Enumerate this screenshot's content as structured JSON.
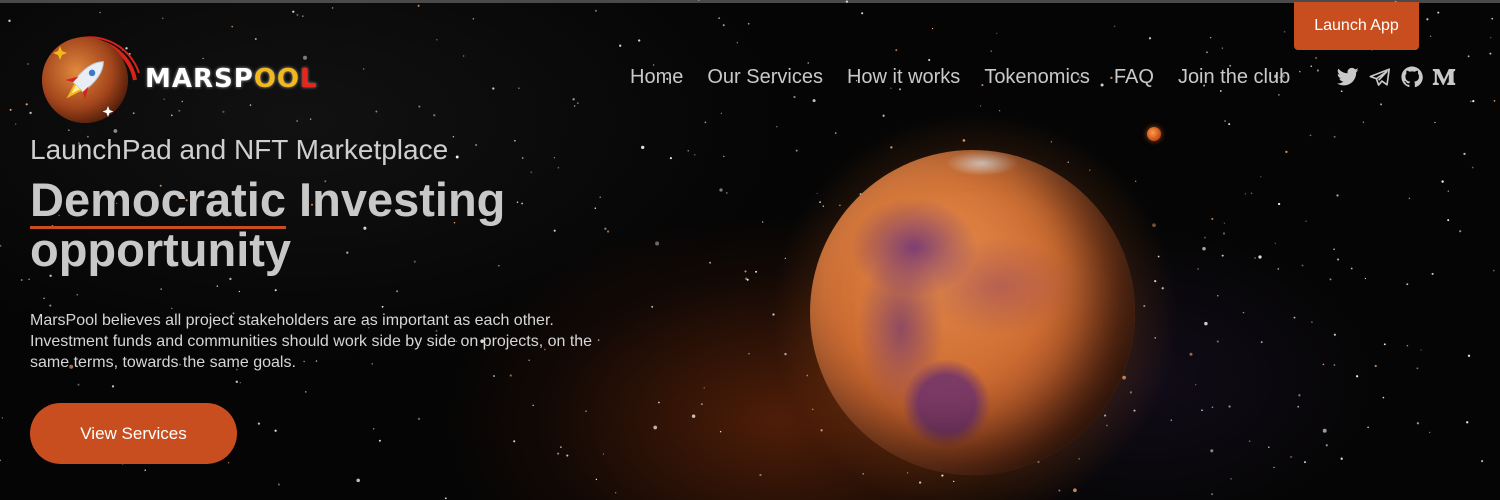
{
  "header": {
    "launch_app_label": "Launch App",
    "logo": {
      "text_parts": [
        "MARS",
        "P",
        "O",
        "O",
        "L"
      ],
      "icon": "rocket-planet-logo-icon"
    },
    "nav": [
      {
        "label": "Home"
      },
      {
        "label": "Our Services"
      },
      {
        "label": "How it works"
      },
      {
        "label": "Tokenomics"
      },
      {
        "label": "FAQ"
      },
      {
        "label": "Join the club"
      }
    ],
    "social": [
      {
        "icon": "twitter-icon"
      },
      {
        "icon": "telegram-icon"
      },
      {
        "icon": "github-icon"
      },
      {
        "icon": "medium-icon"
      }
    ]
  },
  "hero": {
    "subtitle": "LaunchPad and NFT Marketplace",
    "headline_word1": "Democratic",
    "headline_rest": " Investing opportunity",
    "description": "MarsPool believes all project stakeholders are as important as each other. Investment funds and communities should work side by side on projects, on the same terms, towards the same goals.",
    "cta_label": "View Services"
  },
  "colors": {
    "accent": "#c94e1f",
    "nav_text": "#c9c9c9",
    "background": "#050505",
    "logo_yellow": "#f2b81c",
    "logo_red": "#e8261e"
  }
}
